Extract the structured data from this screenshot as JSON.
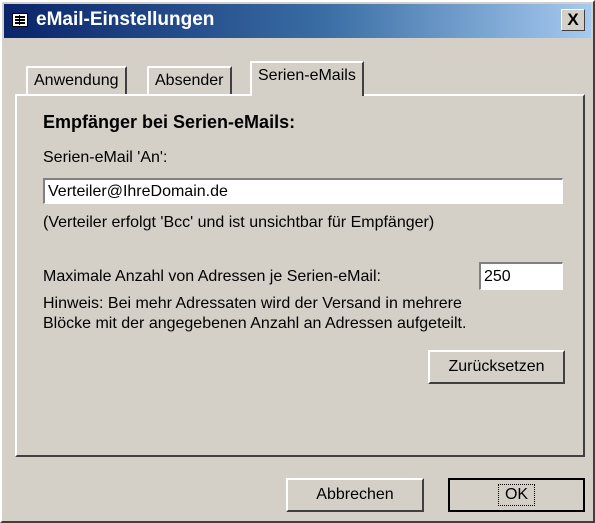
{
  "window": {
    "title": "eMail-Einstellungen",
    "close_label": "X"
  },
  "tabs": [
    {
      "label": "Anwendung",
      "active": false
    },
    {
      "label": "Absender",
      "active": false
    },
    {
      "label": "Serien-eMails",
      "active": true
    }
  ],
  "panel": {
    "heading": "Empfänger bei Serien-eMails:",
    "to_label": "Serien-eMail 'An':",
    "to_value": "Verteiler@IhreDomain.de",
    "to_note": "(Verteiler erfolgt 'Bcc' und ist unsichtbar für Empfänger)",
    "max_label": "Maximale Anzahl von Adressen je Serien-eMail:",
    "max_value": "250",
    "hint_line1": "Hinweis: Bei mehr Adressaten wird der Versand in mehrere",
    "hint_line2": "Blöcke mit der angegebenen Anzahl an Adressen aufgeteilt.",
    "reset_label": "Zurücksetzen"
  },
  "footer": {
    "cancel_label": "Abbrechen",
    "ok_label": "OK"
  }
}
